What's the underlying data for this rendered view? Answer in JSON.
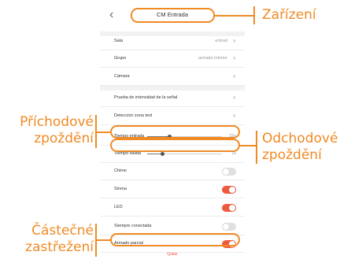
{
  "header": {
    "back_icon": "chevron-left-icon",
    "title": "CM Entrada"
  },
  "settings": {
    "sala": {
      "label": "Sala",
      "value": "entrad"
    },
    "grupo": {
      "label": "Grupo",
      "value": "armado interior"
    },
    "camara": {
      "label": "Cámara"
    },
    "prueba": {
      "label": "Prueba de intensidad de la señal"
    },
    "deteccion": {
      "label": "Detección zona test"
    },
    "tiempo_entrada": {
      "label": "Tiempo entrada",
      "value": "15s",
      "level": 0.3
    },
    "tiempo_salida": {
      "label": "Tiempo salida",
      "value": "1s",
      "level": 0.2
    },
    "chime": {
      "label": "Chime",
      "on": false
    },
    "sirena": {
      "label": "Sirena",
      "on": true
    },
    "led": {
      "label": "LED",
      "on": true
    },
    "siempre": {
      "label": "Siempre conectada",
      "on": false
    },
    "armado": {
      "label": "Armado parcial",
      "on": true
    }
  },
  "footer": {
    "quit_label": "Quitar"
  },
  "annotations": {
    "zarizeni": "Zařízení",
    "prichodove": "Příchodové\nzpoždění",
    "odchodove": "Odchodové\nzpoždění",
    "castecne": "Částečné\nzastřežení"
  },
  "colors": {
    "accent": "#f05a3c",
    "annotation": "#f08a24"
  }
}
